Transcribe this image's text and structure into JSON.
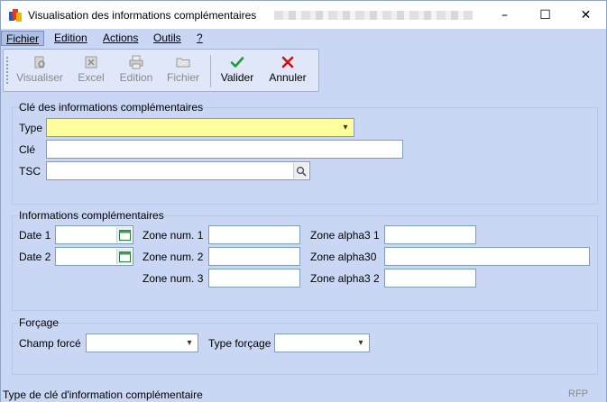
{
  "window": {
    "title": "Visualisation des informations complémentaires",
    "controls": {
      "minimize": "–",
      "maximize": "☐",
      "close": "✕"
    }
  },
  "menu": [
    {
      "label": "Fichier"
    },
    {
      "label": "Edition"
    },
    {
      "label": "Actions"
    },
    {
      "label": "Outils"
    },
    {
      "label": "?"
    }
  ],
  "toolbar": {
    "visualiser": "Visualiser",
    "excel": "Excel",
    "edition": "Edition",
    "fichier": "Fichier",
    "valider": "Valider",
    "annuler": "Annuler"
  },
  "cle": {
    "title": "Clé des informations complémentaires",
    "type_label": "Type",
    "type_value": "",
    "cle_label": "Clé",
    "cle_value": "",
    "tsc_label": "TSC",
    "tsc_value": ""
  },
  "infos": {
    "title": "Informations complémentaires",
    "date1_label": "Date 1",
    "date2_label": "Date 2",
    "num1_label": "Zone num. 1",
    "num2_label": "Zone num. 2",
    "num3_label": "Zone num. 3",
    "alpha31_label": "Zone alpha3 1",
    "alpha30_label": "Zone alpha30",
    "alpha32_label": "Zone alpha3 2"
  },
  "forcage": {
    "title": "Forçage",
    "champ_label": "Champ forcé",
    "type_label": "Type forçage"
  },
  "status": {
    "text": "Type de clé d'information complémentaire",
    "right": "RFP"
  },
  "colors": {
    "panel_bg": "#c9d7f4",
    "required_field": "#ffff9e",
    "valider_green": "#1f9a3a",
    "annuler_red": "#cc1111"
  }
}
